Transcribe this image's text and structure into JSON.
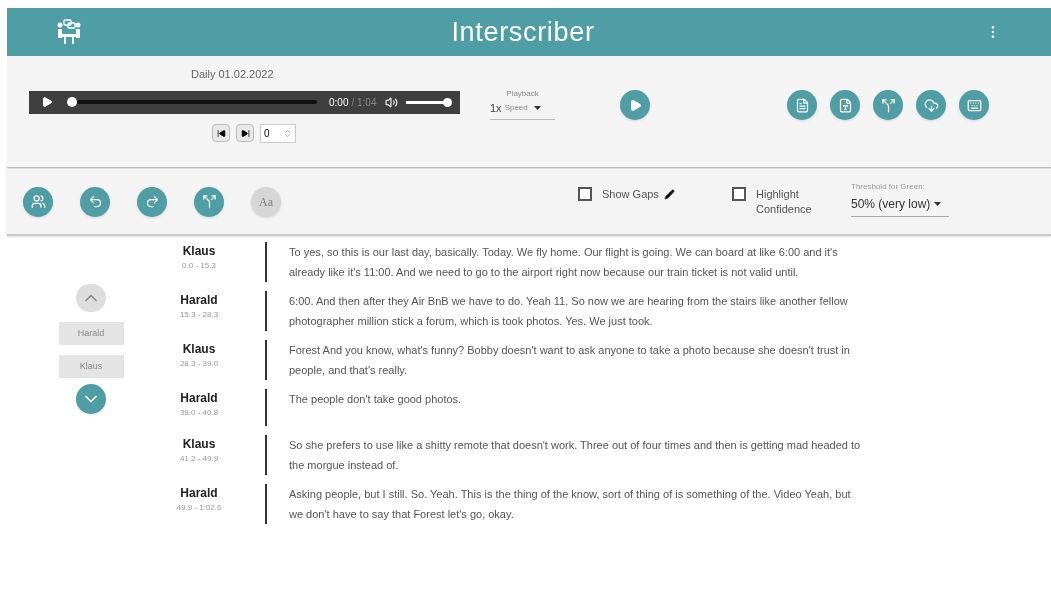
{
  "header": {
    "title": "Interscriber"
  },
  "player": {
    "file_name": "Daily 01.02.2022",
    "current_time": "0:00",
    "duration": "/ 1:04",
    "progress": {
      "level": 0.0
    },
    "volume": {
      "level": 1.0
    }
  },
  "playback": {
    "label": "Playback",
    "speed": "1x",
    "speed_label": "Speed"
  },
  "skip": {
    "value": "0"
  },
  "toolbar": [
    {
      "kind": "speakers",
      "disabled": false
    },
    {
      "kind": "undo",
      "disabled": false
    },
    {
      "kind": "redo",
      "disabled": false
    },
    {
      "kind": "merge",
      "disabled": false
    },
    {
      "kind": "font",
      "label": "Aa",
      "disabled": true
    }
  ],
  "options": [
    {
      "label": "Show Gaps",
      "checked": false,
      "editable": true
    },
    {
      "label": "Highlight Confidence",
      "checked": false,
      "editable": false
    }
  ],
  "threshold": {
    "label": "Threshold for Green:",
    "value": "50% (very low)"
  },
  "navigator": {
    "up_disabled": true,
    "down_disabled": false,
    "speakers": [
      {
        "label": "Harald",
        "disabled": true
      },
      {
        "label": "Klaus",
        "disabled": true
      }
    ]
  },
  "segments": [
    {
      "speaker": "Klaus",
      "time": "0.0 - 15.3",
      "text": "To yes, so this is our last day, basically. Today. We fly home. Our flight is going. We can board at like 6:00 and it's already like it's 11:00. And we need to go to the airport right now because our train ticket is not valid until."
    },
    {
      "speaker": "Harald",
      "time": "15.3 - 28.3",
      "text": "6:00. And then after they Air BnB we have to do. Yeah 11. So now we are hearing from the stairs like another fellow photographer million stick a forum, which is took photos. Yes. We just took."
    },
    {
      "speaker": "Klaus",
      "time": "28.3 - 39.0",
      "text": "Forest And you know, what's funny? Bobby doesn't want to ask anyone to take a photo because she doesn't trust in people, and that's really."
    },
    {
      "speaker": "Harald",
      "time": "39.0 - 40.8",
      "text": "The people don't take good photos."
    },
    {
      "speaker": "Klaus",
      "time": "41.2 - 49.9",
      "text": "So she prefers to use like a shitty remote that doesn't work. Three out of four times and then is getting mad headed to the morgue instead of."
    },
    {
      "speaker": "Harald",
      "time": "49.9 - 1:02.6",
      "text": "Asking people, but I still. So. Yeah. This is the thing of the know, sort of thing of is something of the. Video Yeah, but we don't have to say that Forest let's go, okay."
    }
  ]
}
